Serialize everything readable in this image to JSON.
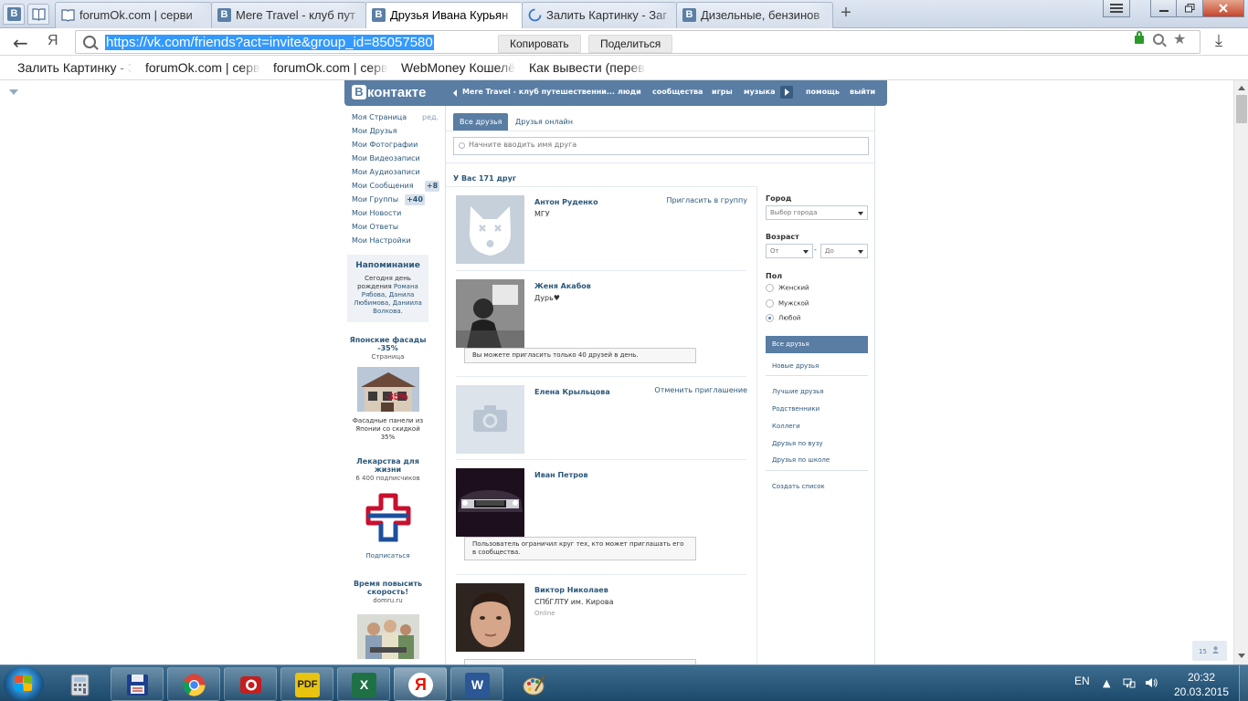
{
  "browser": {
    "tabs": [
      {
        "title": "forumOk.com | серви",
        "icon": "book-icon"
      },
      {
        "title": "Mere Travel - клуб пут",
        "icon": "vk-icon"
      },
      {
        "title": "Друзья Ивана Курьян",
        "icon": "vk-icon",
        "active": true
      },
      {
        "title": "Залить Картинку - Заг",
        "icon": "loading-icon"
      },
      {
        "title": "Дизельные, бензинов",
        "icon": "vk-icon"
      }
    ],
    "pinned_tabs": [
      "vk-icon",
      "book-icon"
    ],
    "url": "https://vk.com/friends?act=invite&group_id=85057580",
    "copy_label": "Копировать",
    "share_label": "Поделиться",
    "search_engine_glyph": "Я",
    "bookmarks": [
      "Залить Картинку - З",
      "forumOk.com | серв",
      "forumOk.com | серв",
      "WebMoney Кошелё",
      "Как вывести (перев"
    ]
  },
  "vk": {
    "logo_b": "В",
    "logo_text": "контакте",
    "group_nav": "Mere Travel - клуб путешественни...",
    "nav": [
      "люди",
      "сообщества",
      "игры",
      "музыка",
      "помощь",
      "выйти"
    ],
    "left_menu": [
      {
        "label": "Моя Страница"
      },
      {
        "label": "Мои Друзья"
      },
      {
        "label": "Мои Фотографии"
      },
      {
        "label": "Мои Видеозаписи"
      },
      {
        "label": "Мои Аудиозаписи"
      },
      {
        "label": "Мои Сообщения",
        "badge": "+8"
      },
      {
        "label": "Мои Группы",
        "badge": "+40"
      },
      {
        "label": "Мои Новости"
      },
      {
        "label": "Мои Ответы"
      },
      {
        "label": "Мои Настройки"
      }
    ],
    "edit_label": "ред.",
    "reminder": {
      "title": "Напоминание",
      "text_pre": "Сегодня день рождения ",
      "names": "Романа Рябова, Данила Любимова, Даниила Волкова."
    },
    "ads": [
      {
        "title": "Японские фасады -35%",
        "subtitle": "Страница",
        "desc": "Фасадные панели из Японии со скидкой 35%",
        "image_caption": "-35%"
      },
      {
        "title": "Лекарства для жизни",
        "subtitle": "6 400 подписчиков",
        "link": "Подписаться"
      },
      {
        "title": "Время повысить скорость!",
        "subtitle": "domru.ru"
      }
    ],
    "tabs": {
      "all": "Все друзья",
      "online": "Друзья онлайн"
    },
    "search_placeholder": "Начните вводить имя друга",
    "friends_count": "У Вас 171 друг",
    "friends": [
      {
        "name": "Антон Руденко",
        "sub": "МГУ",
        "action": "Пригласить в группу",
        "photo": "deactivated-dog"
      },
      {
        "name": "Женя Акабов",
        "sub": "Дурь♥",
        "note": "Вы можете пригласить только 40 друзей в день.",
        "photo": "bw-photo"
      },
      {
        "name": "Елена Крыльцова",
        "action": "Отменить приглашение",
        "photo": "camera-placeholder"
      },
      {
        "name": "Иван Петров",
        "note": "Пользователь ограничил круг тех, кто может приглашать его в сообщества.",
        "photo": "car-photo"
      },
      {
        "name": "Виктор Николаев",
        "sub": "СПбГЛТУ им. Кирова",
        "status": "Online",
        "photo": "face-photo"
      }
    ],
    "filters": {
      "city_label": "Город",
      "city_select": "Выбор города",
      "age_label": "Возраст",
      "age_from": "От",
      "age_to": "До",
      "gender_label": "Пол",
      "genders": [
        "Женский",
        "Мужской",
        "Любой"
      ],
      "selected_gender": "Любой",
      "lists_active": "Все друзья",
      "lists": [
        "Новые друзья",
        "Лучшие друзья",
        "Родственники",
        "Коллеги",
        "Друзья по вузу",
        "Друзья по школе"
      ],
      "create_list": "Создать список"
    },
    "corner_counter": "15"
  },
  "taskbar": {
    "apps": [
      "calculator-icon",
      "save-disk-icon",
      "chrome-icon",
      "camera-app-icon",
      "pdf-icon",
      "excel-icon",
      "yandex-browser-icon",
      "word-icon",
      "paint-icon"
    ],
    "pdf_label": "PDF",
    "excel_label": "X",
    "yandex_label": "Я",
    "word_label": "W",
    "lang": "EN",
    "time": "20:32",
    "date": "20.03.2015"
  }
}
